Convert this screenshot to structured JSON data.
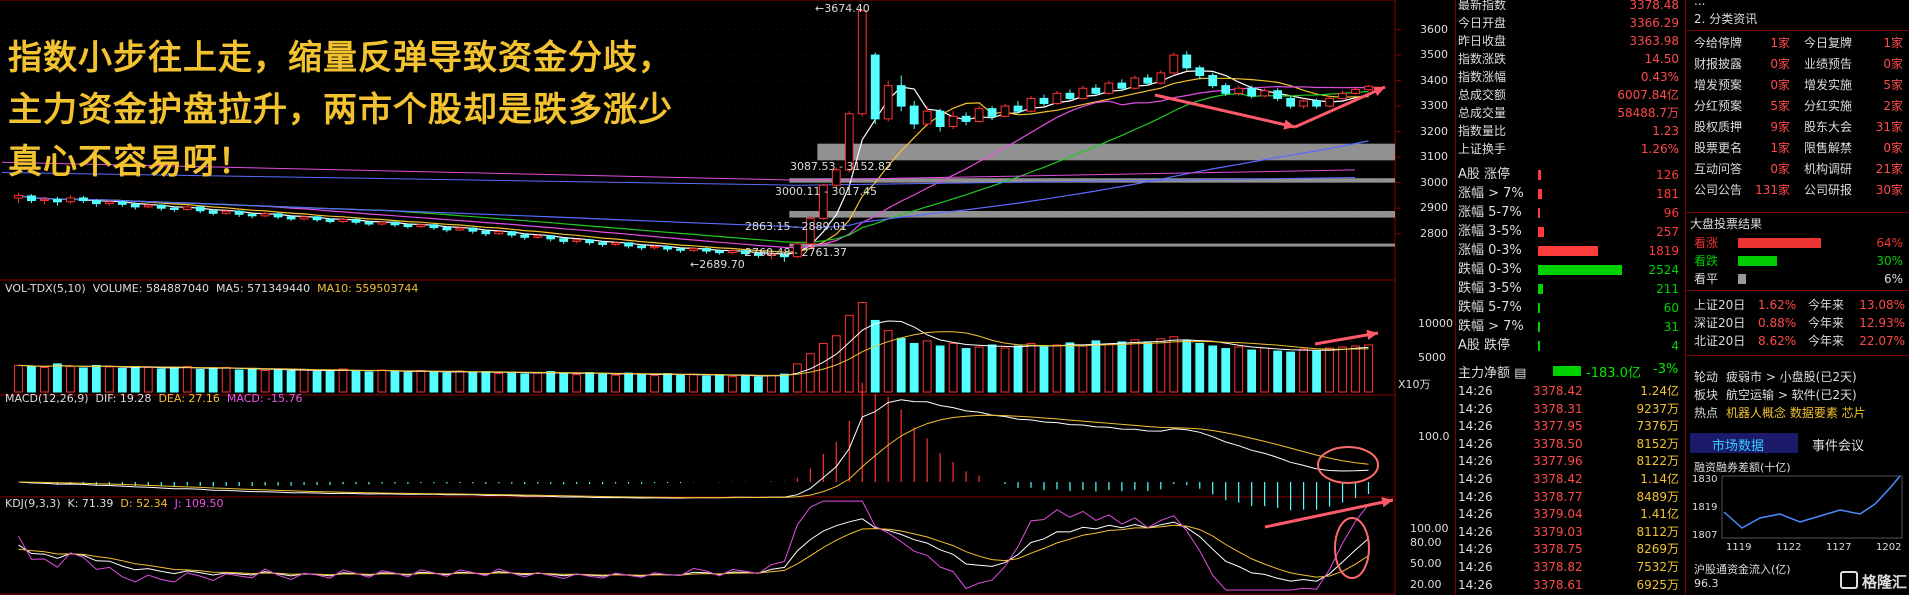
{
  "caption": {
    "lines": [
      "指数小步往上走，缩量反弹导致资金分歧，",
      "主力资金护盘拉升，两市个股却是跌多涨少",
      "真心不容易呀！"
    ]
  },
  "price_axis": [
    "3600",
    "3500",
    "3400",
    "3300",
    "3200",
    "3100",
    "3000",
    "2900",
    "2800"
  ],
  "annotations": {
    "peak": "3674.40",
    "low": "2689.70",
    "box1": "3087.53 - 3152.82",
    "box2": "3000.11 - 3017.45",
    "box3": "2863.15 - 2889.01",
    "box4": "2760.48 - 2761.37"
  },
  "vol_header": {
    "name": "VOL-TDX(5,10)",
    "volume": "VOLUME: 584887040",
    "ma5": "MA5: 571349440",
    "ma10": "MA10: 559503744"
  },
  "vol_axis": [
    "10000",
    "5000"
  ],
  "vol_unit": "X10万",
  "macd_header": {
    "name": "MACD(12,26,9)",
    "dif": "DIF: 19.28",
    "dea": "DEA: 27.16",
    "macd": "MACD: -15.76"
  },
  "macd_axis": [
    "100.0"
  ],
  "kdj_header": {
    "name": "KDJ(9,3,3)",
    "k": "K: 71.39",
    "d": "D: 52.34",
    "j": "J: 109.50"
  },
  "kdj_axis": [
    "100.00",
    "80.00",
    "50.00",
    "20.00"
  ],
  "index_info": [
    {
      "label": "最新指数",
      "value": "3378.48"
    },
    {
      "label": "今日开盘",
      "value": "3366.29"
    },
    {
      "label": "昨日收盘",
      "value": "3363.98"
    },
    {
      "label": "指数涨跌",
      "value": "14.50"
    },
    {
      "label": "指数涨幅",
      "value": "0.43%"
    },
    {
      "label": "总成交额",
      "value": "6007.84亿"
    },
    {
      "label": "总成交量",
      "value": "58488.7万"
    },
    {
      "label": "指数量比",
      "value": "1.23"
    },
    {
      "label": "上证换手",
      "value": "1.26%"
    }
  ],
  "breadth": [
    {
      "label": "A股 涨停",
      "value": "126",
      "color": "#ff3b3b",
      "frac": 0.03
    },
    {
      "label": "涨幅 > 7%",
      "value": "181",
      "color": "#ff3b3b",
      "frac": 0.05
    },
    {
      "label": "涨幅 5-7%",
      "value": "96",
      "color": "#ff3b3b",
      "frac": 0.02
    },
    {
      "label": "涨幅 3-5%",
      "value": "257",
      "color": "#ff3b3b",
      "frac": 0.07
    },
    {
      "label": "涨幅 0-3%",
      "value": "1819",
      "color": "#ff3b3b",
      "frac": 0.72
    },
    {
      "label": "跌幅 0-3%",
      "value": "2524",
      "color": "#00d200",
      "frac": 1.0
    },
    {
      "label": "跌幅 3-5%",
      "value": "211",
      "color": "#00d200",
      "frac": 0.06
    },
    {
      "label": "跌幅 5-7%",
      "value": "60",
      "color": "#00d200",
      "frac": 0.02
    },
    {
      "label": "跌幅 > 7%",
      "value": "31",
      "color": "#00d200",
      "frac": 0.01
    },
    {
      "label": "A股 跌停",
      "value": "4",
      "color": "#00d200",
      "frac": 0.005
    }
  ],
  "main_flow": {
    "label": "主力净额",
    "value": "-183.0亿",
    "pct": "-3%"
  },
  "ticks": [
    {
      "time": "14:26",
      "price": "3378.42",
      "vol": "1.24亿"
    },
    {
      "time": "14:26",
      "price": "3378.31",
      "vol": "9237万"
    },
    {
      "time": "14:26",
      "price": "3377.95",
      "vol": "7376万"
    },
    {
      "time": "14:26",
      "price": "3378.50",
      "vol": "8152万"
    },
    {
      "time": "14:26",
      "price": "3377.96",
      "vol": "8122万"
    },
    {
      "time": "14:26",
      "price": "3378.42",
      "vol": "1.14亿"
    },
    {
      "time": "14:26",
      "price": "3378.77",
      "vol": "8489万"
    },
    {
      "time": "14:26",
      "price": "3379.04",
      "vol": "1.41亿"
    },
    {
      "time": "14:26",
      "price": "3379.03",
      "vol": "8112万"
    },
    {
      "time": "14:26",
      "price": "3378.75",
      "vol": "8269万"
    },
    {
      "time": "14:26",
      "price": "3378.82",
      "vol": "7532万"
    },
    {
      "time": "14:26",
      "price": "3378.61",
      "vol": "6925万"
    }
  ],
  "news_header": "2. 分类资讯",
  "events": [
    {
      "a": "今给停牌",
      "an": "1家",
      "b": "今日复牌",
      "bn": "1家"
    },
    {
      "a": "财报披露",
      "an": "0家",
      "b": "业绩预告",
      "bn": "0家"
    },
    {
      "a": "增发预案",
      "an": "0家",
      "b": "增发实施",
      "bn": "5家"
    },
    {
      "a": "分红预案",
      "an": "5家",
      "b": "分红实施",
      "bn": "2家"
    },
    {
      "a": "股权质押",
      "an": "9家",
      "b": "股东大会",
      "bn": "31家"
    },
    {
      "a": "股票更名",
      "an": "1家",
      "b": "限售解禁",
      "bn": "0家"
    },
    {
      "a": "互动问答",
      "an": "0家",
      "b": "机构调研",
      "bn": "21家"
    },
    {
      "a": "公司公告",
      "an": "131家",
      "b": "公司研报",
      "bn": "30家"
    }
  ],
  "vote": {
    "title": "大盘投票结果",
    "items": [
      {
        "label": "看涨",
        "value": "64%",
        "frac": 0.64,
        "color": "#e33"
      },
      {
        "label": "看跌",
        "value": "30%",
        "frac": 0.3,
        "color": "#0c0"
      },
      {
        "label": "看平",
        "value": "6%",
        "frac": 0.06,
        "color": "#999"
      }
    ]
  },
  "returns": [
    {
      "a": "上证20日",
      "av": "1.62%",
      "b": "今年来",
      "bv": "13.08%"
    },
    {
      "a": "深证20日",
      "av": "0.88%",
      "b": "今年来",
      "bv": "12.93%"
    },
    {
      "a": "北证20日",
      "av": "8.62%",
      "b": "今年来",
      "bv": "22.07%"
    }
  ],
  "rotation": [
    {
      "k": "轮动",
      "v": "疲弱市 > 小盘股(已2天)"
    },
    {
      "k": "板块",
      "v": "航空运输 > 软件(已2天)"
    },
    {
      "k": "热点",
      "v": "机器人概念 数据要素 芯片"
    }
  ],
  "market_tabs": [
    "市场数据",
    "事件会议"
  ],
  "margin_chart": {
    "title": "融资融券差额(十亿)",
    "yticks": [
      "1830",
      "1819",
      "1807"
    ],
    "xticks": [
      "1119",
      "1122",
      "1127",
      "1202"
    ]
  },
  "hk_flow": {
    "title": "沪股通资金流入(亿)",
    "value": "96.3"
  },
  "watermark": "格隆汇",
  "chart_data": {
    "type": "candlestick",
    "title": "",
    "ylim": [
      2650,
      3700
    ],
    "yticks": [
      2800,
      2900,
      3000,
      3100,
      3200,
      3300,
      3400,
      3500,
      3600
    ],
    "peak": 3674.4,
    "low": 2689.7,
    "zones": [
      [
        3087.53,
        3152.82
      ],
      [
        3000.11,
        3017.45
      ],
      [
        2863.15,
        2889.01
      ],
      [
        2760.48,
        2761.37
      ]
    ],
    "candles": [
      [
        2940,
        2950,
        2920,
        2960
      ],
      [
        2948,
        2930,
        2920,
        2955
      ],
      [
        2930,
        2935,
        2915,
        2945
      ],
      [
        2935,
        2925,
        2910,
        2945
      ],
      [
        2925,
        2940,
        2918,
        2950
      ],
      [
        2940,
        2930,
        2920,
        2948
      ],
      [
        2930,
        2918,
        2905,
        2935
      ],
      [
        2918,
        2925,
        2910,
        2932
      ],
      [
        2925,
        2915,
        2905,
        2930
      ],
      [
        2915,
        2905,
        2895,
        2922
      ],
      [
        2905,
        2912,
        2900,
        2920
      ],
      [
        2912,
        2900,
        2890,
        2915
      ],
      [
        2900,
        2895,
        2885,
        2908
      ],
      [
        2895,
        2905,
        2890,
        2912
      ],
      [
        2905,
        2890,
        2880,
        2910
      ],
      [
        2890,
        2880,
        2872,
        2895
      ],
      [
        2880,
        2888,
        2875,
        2895
      ],
      [
        2888,
        2876,
        2866,
        2892
      ],
      [
        2876,
        2870,
        2860,
        2882
      ],
      [
        2870,
        2878,
        2865,
        2885
      ],
      [
        2878,
        2866,
        2858,
        2882
      ],
      [
        2866,
        2858,
        2850,
        2872
      ],
      [
        2858,
        2866,
        2852,
        2872
      ],
      [
        2866,
        2855,
        2846,
        2870
      ],
      [
        2855,
        2848,
        2840,
        2860
      ],
      [
        2848,
        2856,
        2842,
        2862
      ],
      [
        2856,
        2845,
        2836,
        2860
      ],
      [
        2845,
        2838,
        2830,
        2850
      ],
      [
        2838,
        2845,
        2832,
        2850
      ],
      [
        2845,
        2835,
        2826,
        2848
      ],
      [
        2835,
        2828,
        2820,
        2840
      ],
      [
        2828,
        2835,
        2822,
        2840
      ],
      [
        2835,
        2824,
        2815,
        2838
      ],
      [
        2824,
        2815,
        2806,
        2828
      ],
      [
        2815,
        2822,
        2810,
        2828
      ],
      [
        2822,
        2810,
        2800,
        2825
      ],
      [
        2810,
        2800,
        2790,
        2815
      ],
      [
        2800,
        2808,
        2795,
        2812
      ],
      [
        2808,
        2795,
        2785,
        2812
      ],
      [
        2795,
        2786,
        2776,
        2800
      ],
      [
        2786,
        2792,
        2780,
        2798
      ],
      [
        2792,
        2780,
        2770,
        2795
      ],
      [
        2780,
        2770,
        2760,
        2785
      ],
      [
        2770,
        2776,
        2762,
        2780
      ],
      [
        2776,
        2765,
        2755,
        2780
      ],
      [
        2765,
        2758,
        2748,
        2770
      ],
      [
        2758,
        2764,
        2752,
        2770
      ],
      [
        2764,
        2752,
        2742,
        2768
      ],
      [
        2752,
        2745,
        2735,
        2758
      ],
      [
        2745,
        2750,
        2738,
        2756
      ],
      [
        2750,
        2740,
        2730,
        2755
      ],
      [
        2740,
        2735,
        2725,
        2745
      ],
      [
        2735,
        2742,
        2730,
        2748
      ],
      [
        2742,
        2732,
        2722,
        2746
      ],
      [
        2732,
        2726,
        2718,
        2738
      ],
      [
        2726,
        2733,
        2720,
        2738
      ],
      [
        2733,
        2722,
        2712,
        2736
      ],
      [
        2722,
        2715,
        2705,
        2728
      ],
      [
        2715,
        2720,
        2700,
        2725
      ],
      [
        2720,
        2710,
        2690,
        2724
      ],
      [
        2710,
        2760,
        2705,
        2765
      ],
      [
        2760,
        2860,
        2755,
        2870
      ],
      [
        2860,
        2990,
        2855,
        2995
      ],
      [
        2990,
        3050,
        2980,
        3060
      ],
      [
        3050,
        3270,
        3040,
        3280
      ],
      [
        3270,
        3674,
        3260,
        3674
      ],
      [
        3500,
        3250,
        3230,
        3510
      ],
      [
        3250,
        3380,
        3240,
        3400
      ],
      [
        3380,
        3300,
        3280,
        3420
      ],
      [
        3300,
        3230,
        3210,
        3320
      ],
      [
        3230,
        3280,
        3220,
        3300
      ],
      [
        3280,
        3220,
        3200,
        3290
      ],
      [
        3220,
        3260,
        3210,
        3280
      ],
      [
        3260,
        3240,
        3225,
        3275
      ],
      [
        3240,
        3290,
        3235,
        3300
      ],
      [
        3290,
        3260,
        3245,
        3300
      ],
      [
        3260,
        3300,
        3255,
        3310
      ],
      [
        3300,
        3280,
        3270,
        3320
      ],
      [
        3280,
        3330,
        3275,
        3340
      ],
      [
        3330,
        3310,
        3300,
        3345
      ],
      [
        3310,
        3350,
        3305,
        3360
      ],
      [
        3350,
        3330,
        3320,
        3365
      ],
      [
        3330,
        3370,
        3325,
        3380
      ],
      [
        3370,
        3350,
        3340,
        3385
      ],
      [
        3350,
        3390,
        3345,
        3400
      ],
      [
        3390,
        3370,
        3360,
        3405
      ],
      [
        3370,
        3410,
        3365,
        3420
      ],
      [
        3410,
        3390,
        3380,
        3425
      ],
      [
        3390,
        3430,
        3385,
        3440
      ],
      [
        3430,
        3500,
        3420,
        3510
      ],
      [
        3500,
        3450,
        3440,
        3515
      ],
      [
        3450,
        3420,
        3405,
        3460
      ],
      [
        3420,
        3380,
        3370,
        3430
      ],
      [
        3380,
        3350,
        3340,
        3390
      ],
      [
        3350,
        3370,
        3340,
        3380
      ],
      [
        3370,
        3340,
        3330,
        3380
      ],
      [
        3340,
        3360,
        3335,
        3370
      ],
      [
        3360,
        3330,
        3320,
        3370
      ],
      [
        3330,
        3300,
        3290,
        3340
      ],
      [
        3300,
        3320,
        3290,
        3330
      ],
      [
        3320,
        3300,
        3290,
        3330
      ],
      [
        3300,
        3330,
        3295,
        3340
      ],
      [
        3330,
        3350,
        3325,
        3360
      ],
      [
        3350,
        3365,
        3345,
        3372
      ],
      [
        3364,
        3378,
        3360,
        3382
      ]
    ],
    "volume_approx": [
      52,
      50,
      48,
      55,
      50,
      47,
      52,
      49,
      46,
      50,
      48,
      45,
      47,
      50,
      44,
      46,
      48,
      43,
      45,
      42,
      44,
      41,
      43,
      40,
      42,
      45,
      41,
      39,
      43,
      40,
      38,
      42,
      39,
      37,
      41,
      38,
      40,
      36,
      39,
      35,
      37,
      40,
      36,
      34,
      38,
      35,
      33,
      37,
      34,
      32,
      36,
      33,
      35,
      31,
      34,
      30,
      33,
      29,
      32,
      35,
      55,
      75,
      95,
      110,
      150,
      175,
      140,
      120,
      105,
      95,
      100,
      90,
      95,
      85,
      88,
      92,
      86,
      90,
      95,
      88,
      92,
      96,
      90,
      100,
      94,
      98,
      102,
      96,
      104,
      108,
      100,
      95,
      90,
      85,
      88,
      82,
      86,
      80,
      78,
      84,
      80,
      86,
      88,
      90,
      92
    ],
    "kdj_note": "K 71.39 D 52.34 J 109.50",
    "macd_note": "DIF 19.28 DEA 27.16 MACD -15.76"
  }
}
